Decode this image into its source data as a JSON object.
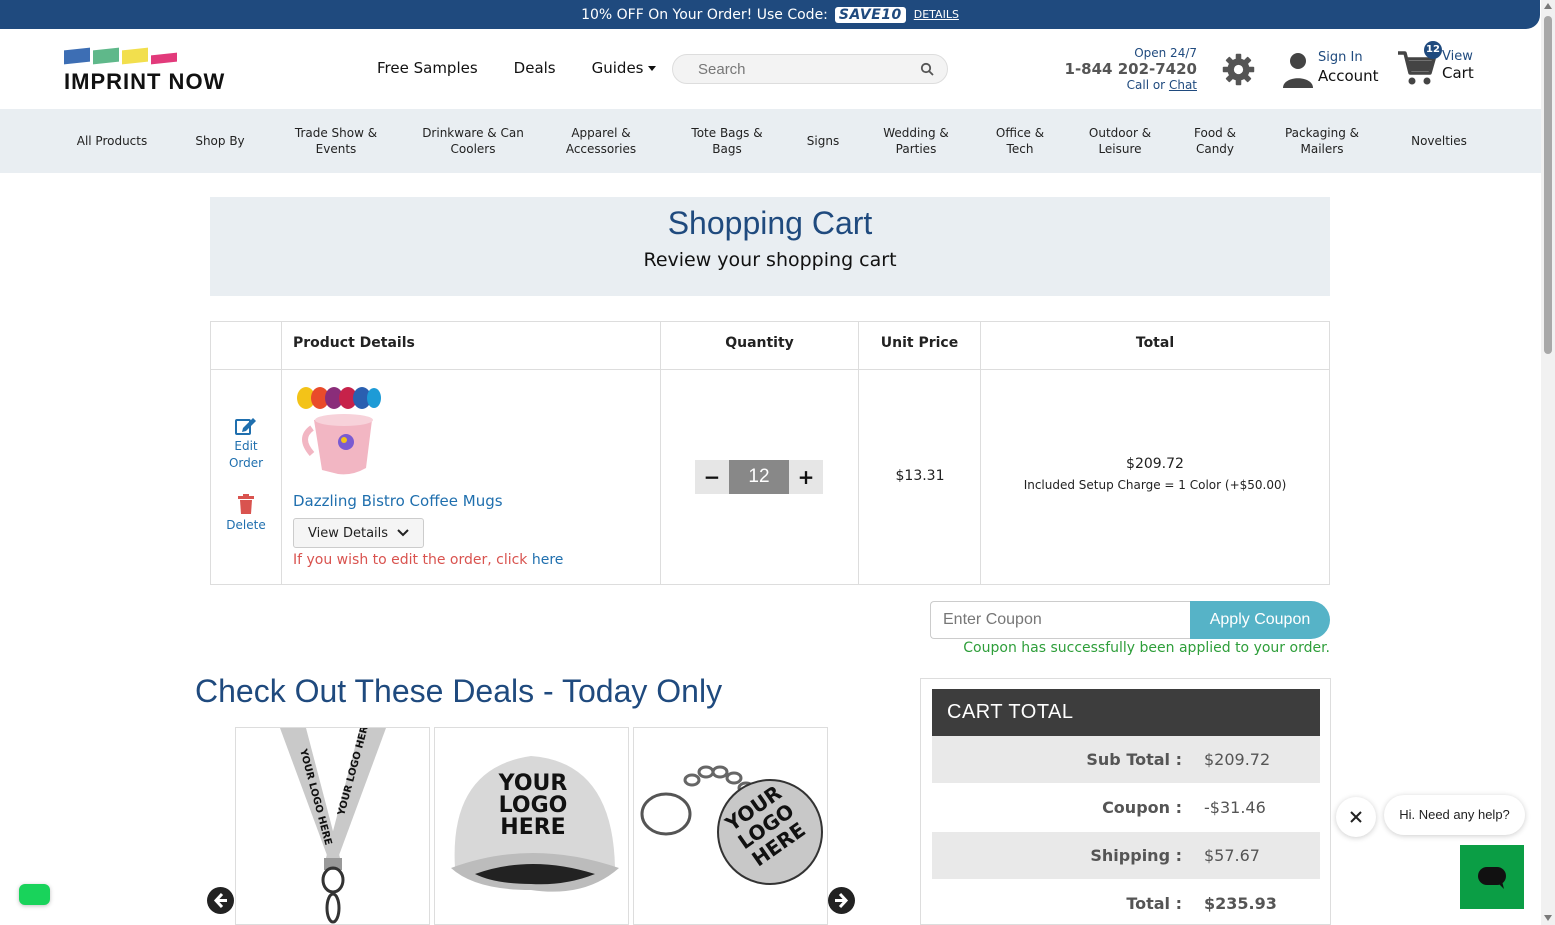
{
  "promo": {
    "text": "10% OFF On Your Order! Use Code:",
    "code": "SAVE10",
    "details": "DETAILS"
  },
  "logo": {
    "text": "IMPRINT NOW",
    "colors": [
      "#3d6eb4",
      "#5fb88a",
      "#f2df4d",
      "#e23a7b"
    ]
  },
  "nav": {
    "free_samples": "Free Samples",
    "deals": "Deals",
    "guides": "Guides"
  },
  "search": {
    "placeholder": "Search"
  },
  "contact": {
    "open": "Open 24/7",
    "phone": "1-844 202-7420",
    "call_or": "Call or",
    "chat": "Chat"
  },
  "account": {
    "signin": "Sign In",
    "account": "Account"
  },
  "cart_icon": {
    "badge": "12",
    "view": "View",
    "cart": "Cart"
  },
  "categories": [
    "All Products",
    "Shop By",
    "Trade Show & Events",
    "Drinkware & Can Coolers",
    "Apparel & Accessories",
    "Tote Bags & Bags",
    "Signs",
    "Wedding & Parties",
    "Office & Tech",
    "Outdoor & Leisure",
    "Food & Candy",
    "Packaging & Mailers",
    "Novelties"
  ],
  "page": {
    "title": "Shopping Cart",
    "subtitle": "Review your shopping cart"
  },
  "table": {
    "headers": {
      "details": "Product Details",
      "quantity": "Quantity",
      "unit_price": "Unit Price",
      "total": "Total"
    },
    "row": {
      "edit_order": "Edit Order",
      "delete": "Delete",
      "product_name": "Dazzling Bistro Coffee Mugs",
      "view_details": "View Details",
      "edit_note": "If you wish to edit the order, click",
      "edit_link": "here",
      "quantity": "12",
      "unit_price": "$13.31",
      "total": "$209.72",
      "setup": "Included Setup Charge = 1 Color (+$50.00)"
    }
  },
  "coupon": {
    "placeholder": "Enter Coupon",
    "button": "Apply Coupon",
    "message": "Coupon has successfully been applied to your order."
  },
  "deals": {
    "title": "Check Out These Deals - Today Only",
    "lanyard_text": "YOUR LOGO HERE",
    "cap_text": [
      "YOUR",
      "LOGO",
      "HERE"
    ],
    "keychain_text": [
      "YOUR",
      "LOGO",
      "HERE"
    ]
  },
  "cart_total": {
    "title": "CART TOTAL",
    "rows": [
      {
        "label": "Sub Total :",
        "value": "$209.72"
      },
      {
        "label": "Coupon :",
        "value": "-$31.46"
      },
      {
        "label": "Shipping :",
        "value": "$57.67"
      },
      {
        "label": "Total :",
        "value": "$235.93"
      }
    ]
  },
  "chat": {
    "bubble": "Hi. Need any help?"
  },
  "colors": {
    "brand": "#1f4a7e",
    "link": "#1f6fae",
    "accent": "#56b3c7",
    "success": "#2e9e3a",
    "danger": "#d9534f"
  }
}
